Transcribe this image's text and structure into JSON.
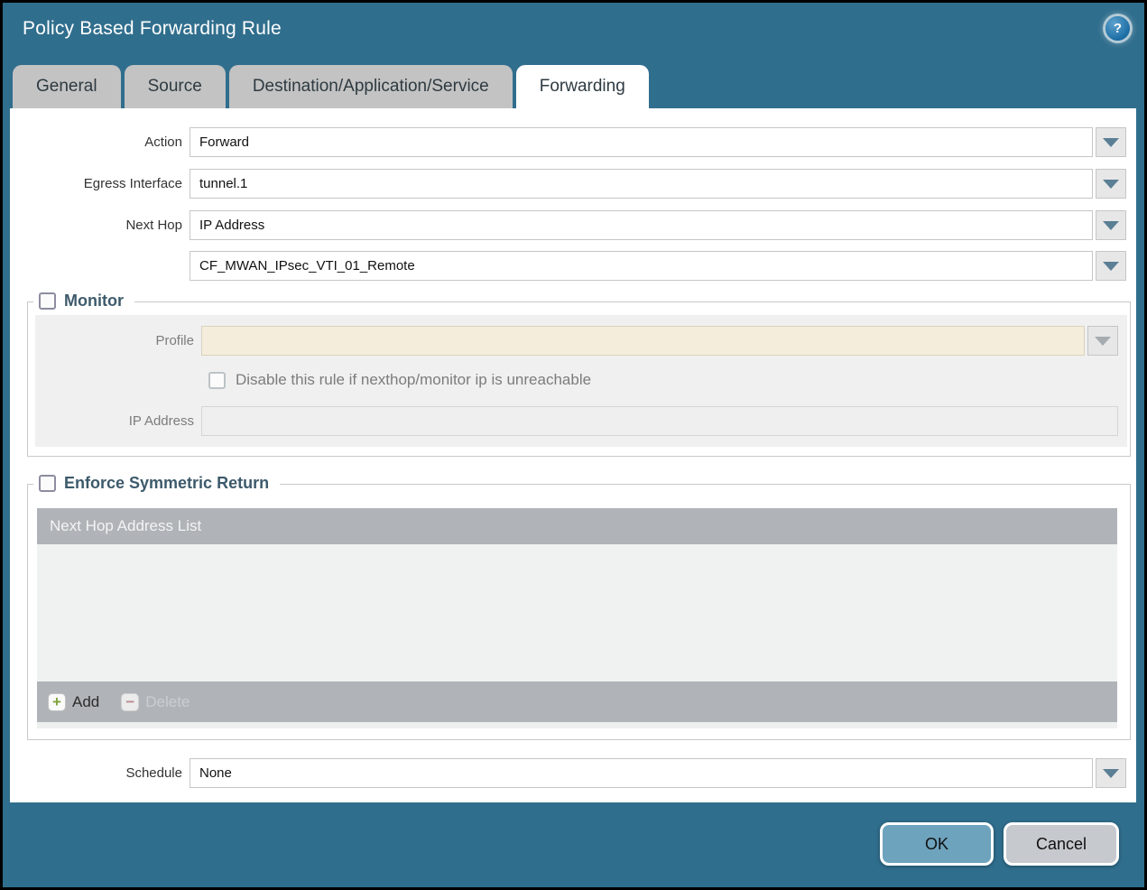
{
  "window": {
    "title": "Policy Based Forwarding Rule",
    "help_glyph": "?"
  },
  "tabs": [
    {
      "label": "General",
      "active": false
    },
    {
      "label": "Source",
      "active": false
    },
    {
      "label": "Destination/Application/Service",
      "active": false
    },
    {
      "label": "Forwarding",
      "active": true
    }
  ],
  "fields": {
    "action": {
      "label": "Action",
      "value": "Forward"
    },
    "egress_interface": {
      "label": "Egress Interface",
      "value": "tunnel.1"
    },
    "next_hop": {
      "label": "Next Hop",
      "value": "IP Address"
    },
    "next_hop_address": {
      "value": "CF_MWAN_IPsec_VTI_01_Remote"
    },
    "schedule": {
      "label": "Schedule",
      "value": "None"
    }
  },
  "monitor": {
    "legend": "Monitor",
    "checked": false,
    "profile_label": "Profile",
    "profile_value": "",
    "disable_rule_label": "Disable this rule if nexthop/monitor ip is unreachable",
    "disable_rule_checked": false,
    "ip_address_label": "IP Address",
    "ip_address_value": ""
  },
  "enforce": {
    "legend": "Enforce Symmetric Return",
    "checked": false,
    "table_header": "Next Hop Address List",
    "rows": [],
    "add_label": "Add",
    "delete_label": "Delete"
  },
  "actions": {
    "ok": "OK",
    "cancel": "Cancel"
  },
  "colors": {
    "titlebar_teal": "#306e8d",
    "tab_inactive_gray": "#c3c3c3",
    "legend_slate": "#3d5a6b",
    "disabled_field_beige": "#f5eddc",
    "table_chrome_gray": "#b0b4b8",
    "ok_button_blue": "#6ea3bd",
    "cancel_button_gray": "#c6c9cd",
    "add_icon_green": "#7fa33a",
    "delete_icon_red": "#b98b90"
  }
}
